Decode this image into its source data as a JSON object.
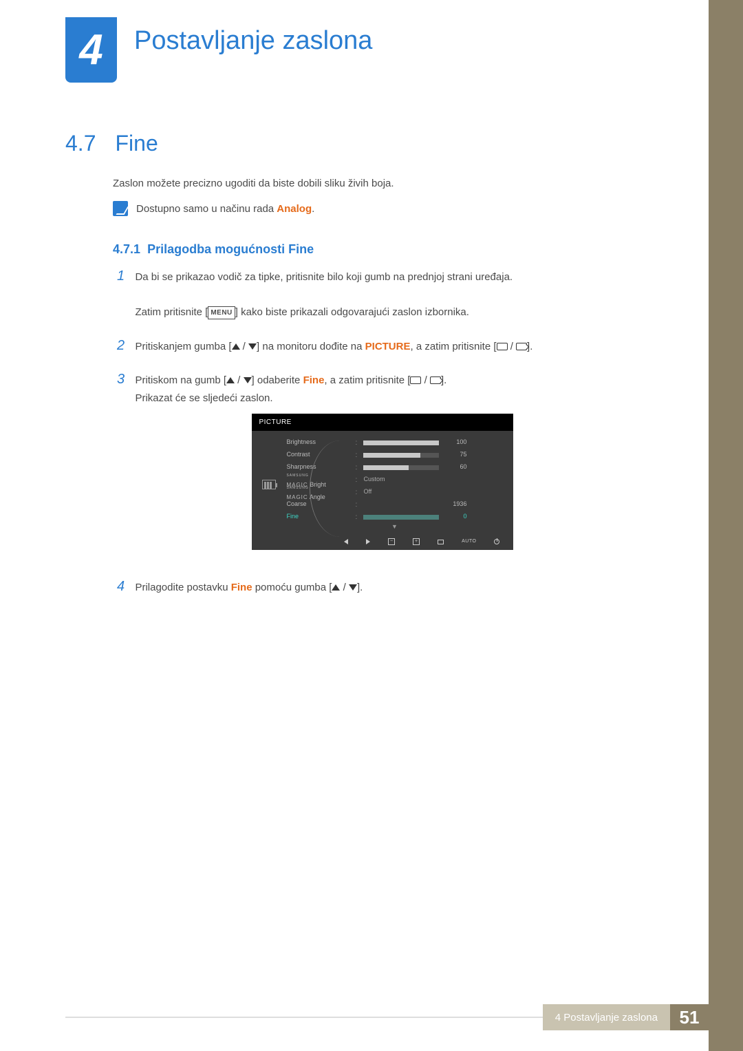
{
  "chapter": {
    "number": "4",
    "title": "Postavljanje zaslona"
  },
  "section": {
    "number": "4.7",
    "title": "Fine"
  },
  "intro": "Zaslon možete precizno ugoditi da biste dobili sliku živih boja.",
  "note": {
    "prefix": "Dostupno samo u načinu rada ",
    "mode": "Analog",
    "suffix": "."
  },
  "subsection": {
    "number": "4.7.1",
    "title": "Prilagodba mogućnosti Fine"
  },
  "steps": {
    "s1": {
      "line1": "Da bi se prikazao vodič za tipke, pritisnite bilo koji gumb na prednjoj strani uređaja.",
      "line2a": "Zatim pritisnite [",
      "menu": "MENU",
      "line2b": "] kako biste prikazali odgovarajući zaslon izbornika."
    },
    "s2": {
      "a": "Pritiskanjem gumba [",
      "b": "] na monitoru dođite na ",
      "picture": "PICTURE",
      "c": ", a zatim pritisnite [",
      "d": "]."
    },
    "s3": {
      "a": "Pritiskom na gumb [",
      "b": "] odaberite ",
      "fine": "Fine",
      "c": ", a zatim pritisnite [",
      "d": "].",
      "e": "Prikazat će se sljedeći zaslon."
    },
    "s4": {
      "a": "Prilagodite postavku ",
      "fine": "Fine",
      "b": " pomoću gumba [",
      "c": "]."
    }
  },
  "osd": {
    "title": "PICTURE",
    "rows": {
      "brightness": {
        "label": "Brightness",
        "value": "100",
        "fill": 100
      },
      "contrast": {
        "label": "Contrast",
        "value": "75",
        "fill": 75
      },
      "sharpness": {
        "label": "Sharpness",
        "value": "60",
        "fill": 60
      },
      "magic_bright": {
        "brand": "SAMSUNG",
        "sub": "MAGIC",
        "suffix": "Bright",
        "value": "Custom"
      },
      "magic_angle": {
        "brand": "SAMSUNG",
        "sub": "MAGIC",
        "suffix": "Angle",
        "value": "Off"
      },
      "coarse": {
        "label": "Coarse",
        "value": "1936"
      },
      "fine": {
        "label": "Fine",
        "value": "0",
        "fill": 0
      }
    },
    "footer_auto": "AUTO"
  },
  "footer": {
    "text": "4 Postavljanje zaslona",
    "page": "51"
  }
}
